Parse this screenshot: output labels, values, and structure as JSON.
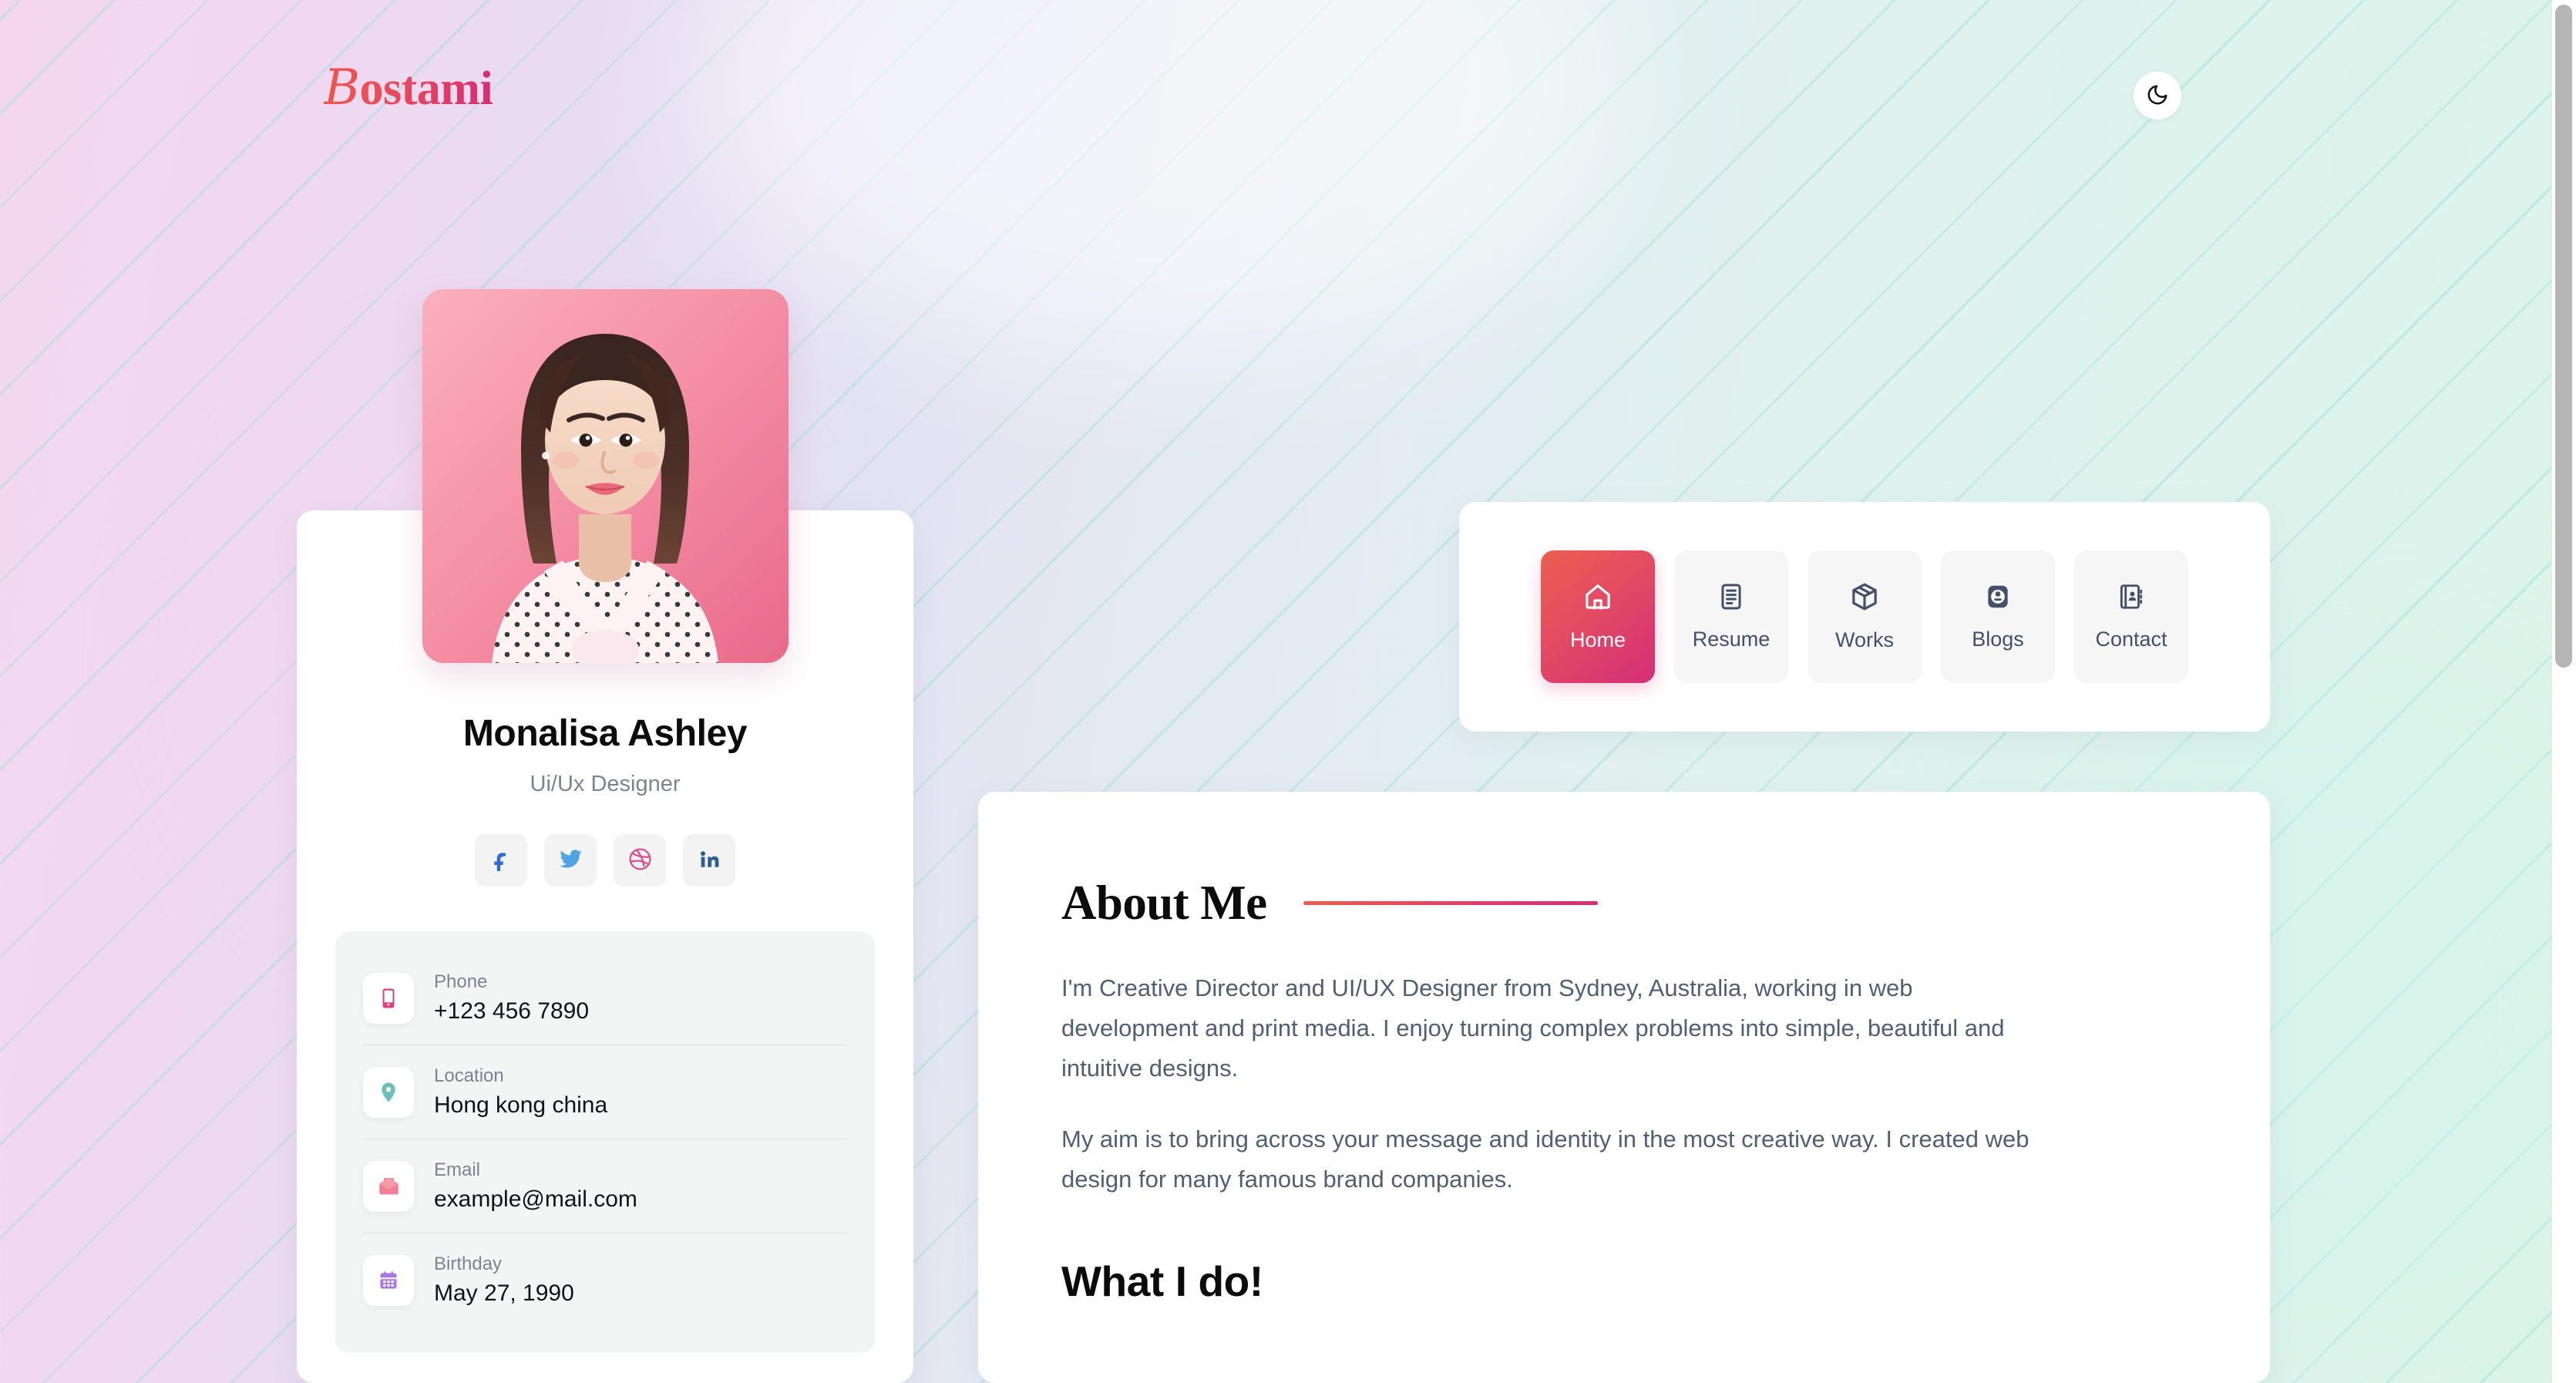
{
  "brand": {
    "logo_initial": "B",
    "logo_rest": "ostami",
    "logo_full": "Bostami",
    "gradient_from": "#f0564a",
    "gradient_to": "#d62d72"
  },
  "header": {
    "theme_toggle": {
      "icon": "moon-icon",
      "label": "Dark mode"
    }
  },
  "profile": {
    "avatar_alt": "Monalisa Ashley portrait",
    "name": "Monalisa Ashley",
    "role": "Ui/Ux Designer",
    "socials": [
      {
        "name": "facebook",
        "icon": "facebook-icon",
        "color": "#2c6bd8"
      },
      {
        "name": "twitter",
        "icon": "twitter-icon",
        "color": "#4fa3e3"
      },
      {
        "name": "dribbble",
        "icon": "dribbble-icon",
        "color": "#dd4b86"
      },
      {
        "name": "linkedin",
        "icon": "linkedin-icon",
        "color": "#2d5f8f"
      }
    ],
    "contact": [
      {
        "icon": "mobile-icon",
        "icon_color": "#d8427c",
        "label": "Phone",
        "value": "+123 456 7890"
      },
      {
        "icon": "location-icon",
        "icon_color": "#6cbfbd",
        "label": "Location",
        "value": "Hong kong china"
      },
      {
        "icon": "email-icon",
        "icon_color": "#ef7f92",
        "label": "Email",
        "value": "example@mail.com"
      },
      {
        "icon": "calendar-icon",
        "icon_color": "#a976e8",
        "label": "Birthday",
        "value": "May 27, 1990"
      }
    ]
  },
  "nav": {
    "items": [
      {
        "label": "Home",
        "icon": "home-icon",
        "active": true
      },
      {
        "label": "Resume",
        "icon": "resume-icon",
        "active": false
      },
      {
        "label": "Works",
        "icon": "works-icon",
        "active": false
      },
      {
        "label": "Blogs",
        "icon": "blogs-icon",
        "active": false
      },
      {
        "label": "Contact",
        "icon": "contact-icon",
        "active": false
      }
    ],
    "active_gradient_from": "#ec5f4f",
    "active_gradient_to": "#d42e78"
  },
  "main": {
    "about": {
      "title": "About Me",
      "paragraphs": [
        "I'm Creative Director and UI/UX Designer from Sydney, Australia, working in web development and print media. I enjoy turning complex problems into simple, beautiful and intuitive designs.",
        "My aim is to bring across your message and identity in the most creative way. I created web design for many famous brand companies."
      ]
    },
    "what_i_do": {
      "title": "What I do!"
    }
  },
  "scrollbar": {
    "orientation": "vertical",
    "position": "right"
  }
}
